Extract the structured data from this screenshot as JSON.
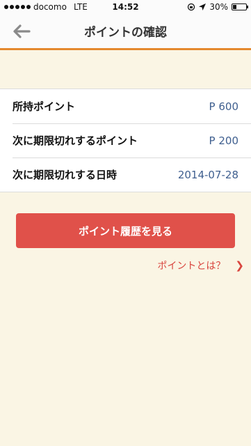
{
  "status_bar": {
    "carrier": "docomo",
    "network": "LTE",
    "time": "14:52",
    "battery": "30%",
    "battery_level": 0.3
  },
  "nav": {
    "back_icon": "back-arrow-icon",
    "title": "ポイントの確認"
  },
  "info": {
    "rows": [
      {
        "label": "所持ポイント",
        "value": "P 600"
      },
      {
        "label": "次に期限切れするポイント",
        "value": "P 200"
      },
      {
        "label": "次に期限切れする日時",
        "value": "2014-07-28"
      }
    ]
  },
  "actions": {
    "history_button": "ポイント履歴を見る",
    "about_link": "ポイントとは？",
    "about_icon": "chevron-right-icon"
  },
  "colors": {
    "background": "#faf5e4",
    "accent_orange": "#e5892e",
    "button_red": "#e0514a",
    "link_red": "#d9453e",
    "value_blue": "#3f5f8f"
  }
}
